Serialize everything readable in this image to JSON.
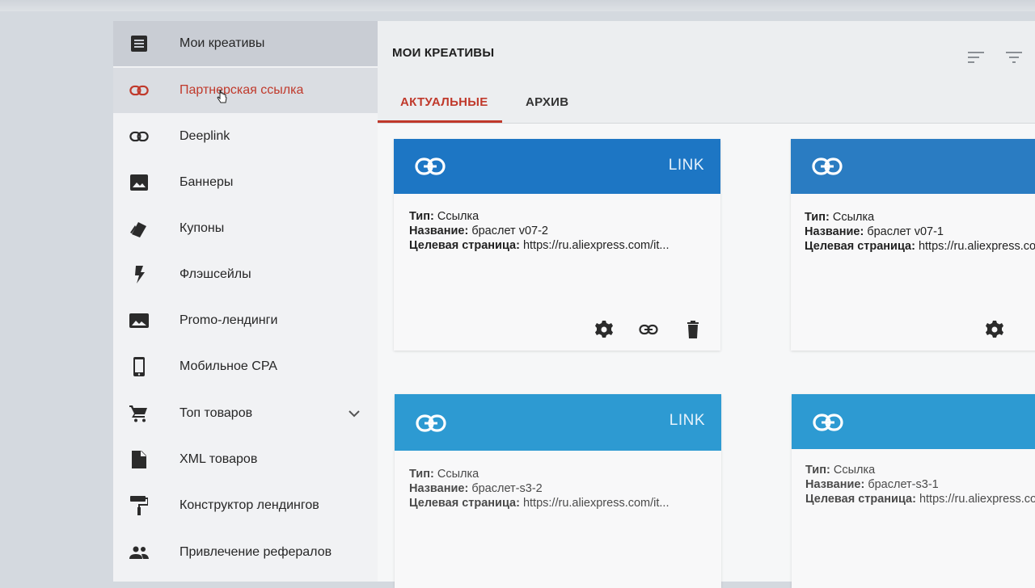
{
  "sidebar": {
    "items": [
      {
        "label": "Мои креативы",
        "icon": "list-icon"
      },
      {
        "label": "Партнерская ссылка",
        "icon": "link-icon",
        "active": true
      },
      {
        "label": "Deeplink",
        "icon": "link-icon"
      },
      {
        "label": "Баннеры",
        "icon": "image-icon"
      },
      {
        "label": "Купоны",
        "icon": "coupon-icon"
      },
      {
        "label": "Флэшсейлы",
        "icon": "flash-icon"
      },
      {
        "label": "Promo-лендинги",
        "icon": "image-icon"
      },
      {
        "label": "Мобильное CPA",
        "icon": "phone-icon"
      },
      {
        "label": "Топ товаров",
        "icon": "cart-icon"
      },
      {
        "label": "XML товаров",
        "icon": "file-icon"
      },
      {
        "label": "Конструктор лендингов",
        "icon": "paint-roller-icon"
      },
      {
        "label": "Привлечение рефералов",
        "icon": "people-icon"
      }
    ]
  },
  "header": {
    "title": "МОИ КРЕАТИВЫ"
  },
  "tabs": [
    {
      "label": "АКТУАЛЬНЫЕ",
      "active": true
    },
    {
      "label": "АРХИВ",
      "active": false
    }
  ],
  "cards": [
    {
      "badge": "LINK",
      "type_key": "Тип:",
      "type_val": "Ссылка",
      "name_key": "Название:",
      "name_val": "браслет v07-2",
      "target_key": "Целевая страница:",
      "target_val": "https://ru.aliexpress.com/it..."
    },
    {
      "badge": "",
      "type_key": "Тип:",
      "type_val": "Ссылка",
      "name_key": "Название:",
      "name_val": "браслет v07-1",
      "target_key": "Целевая страница:",
      "target_val": "https://ru.aliexpress.com"
    },
    {
      "badge": "LINK",
      "type_key": "Тип:",
      "type_val": "Ссылка",
      "name_key": "Название:",
      "name_val": "браслет-s3-2",
      "target_key": "Целевая страница:",
      "target_val": "https://ru.aliexpress.com/it..."
    },
    {
      "badge": "",
      "type_key": "Тип:",
      "type_val": "Ссылка",
      "name_key": "Название:",
      "name_val": "браслет-s3-1",
      "target_key": "Целевая страница:",
      "target_val": "https://ru.aliexpress.com"
    }
  ],
  "colors": {
    "accent": "#c0392b",
    "card_header_dark": "#1d76c4",
    "card_header_light": "#2d9ad2"
  }
}
